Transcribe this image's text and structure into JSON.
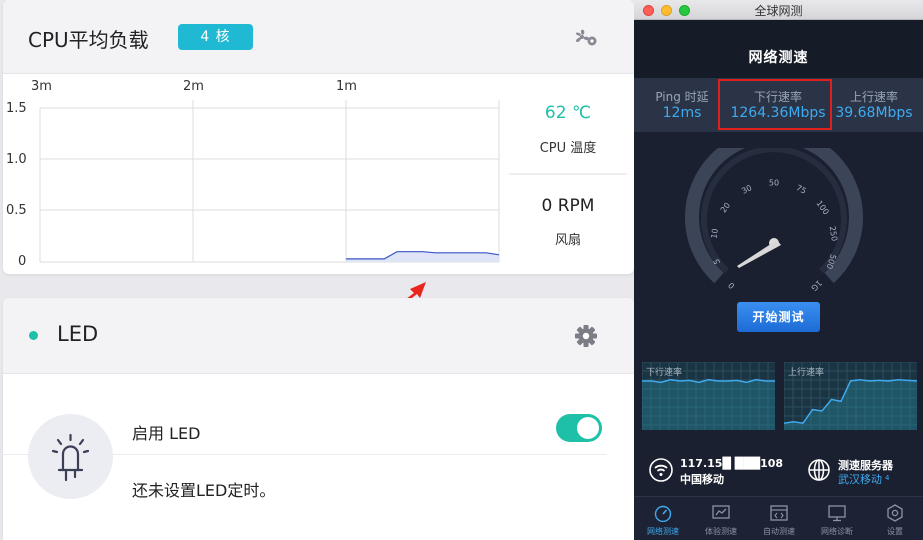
{
  "cpu": {
    "title": "CPU平均负载",
    "cores_badge": "4 核",
    "x_ticks": [
      "3m",
      "2m",
      "1m"
    ],
    "y_ticks": [
      "1.5",
      "1.0",
      "0.5",
      "0"
    ],
    "temperature": "62 ℃",
    "temperature_label": "CPU 温度",
    "fan_speed": "0 RPM",
    "fan_label": "风扇"
  },
  "chart_data": {
    "type": "area",
    "x": [
      0,
      5,
      10,
      15,
      20,
      25,
      30,
      35,
      40,
      45,
      50,
      55,
      60
    ],
    "values": [
      0.03,
      0.03,
      0.03,
      0.03,
      0.1,
      0.1,
      0.1,
      0.09,
      0.09,
      0.09,
      0.09,
      0.09,
      0.07
    ],
    "xlabel": "",
    "ylabel": "",
    "ylim": [
      0,
      1.5
    ],
    "x_tick_labels": [
      "3m",
      "2m",
      "1m"
    ],
    "y_tick_labels": [
      "1.5",
      "1.0",
      "0.5",
      "0"
    ],
    "grid": true,
    "colors": {
      "line": "#3a55c4",
      "fill": "#dfe4f7"
    }
  },
  "led": {
    "title": "LED",
    "enable_label": "启用 LED",
    "enabled": true,
    "note": "还未设置LED定时。",
    "status_color": "#1fc0a8"
  },
  "speedtest": {
    "window_title": "全球网测",
    "header": "网络测速",
    "ping_label": "Ping 时延",
    "ping_value": "12ms",
    "download_label": "下行速率",
    "download_value": "1264.36Mbps",
    "upload_label": "上行速率",
    "upload_value": "39.68Mbps",
    "gauge_labels": [
      "0",
      "5",
      "10",
      "20",
      "30",
      "50",
      "75",
      "100",
      "250",
      "500",
      "1G"
    ],
    "start_button": "开始测试",
    "mini_download_label": "下行速率",
    "mini_upload_label": "上行速率",
    "mini_download_data": [
      0.72,
      0.72,
      0.7,
      0.74,
      0.72,
      0.73,
      0.7,
      0.74,
      0.72,
      0.72,
      0.73,
      0.7,
      0.74,
      0.72,
      0.72
    ],
    "mini_upload_data": [
      0.1,
      0.12,
      0.1,
      0.3,
      0.28,
      0.45,
      0.42,
      0.72,
      0.74,
      0.72,
      0.73,
      0.72,
      0.74,
      0.73,
      0.72
    ],
    "ip_address": "117.15█ ███108",
    "isp": "中国移动",
    "server_label": "测速服务器",
    "server_name": "武汉移动",
    "server_index": "4",
    "tabs": [
      "网络测速",
      "体验测速",
      "自动测速",
      "网络诊断",
      "设置"
    ],
    "active_tab": 0,
    "accent": "#3eaaf0"
  }
}
